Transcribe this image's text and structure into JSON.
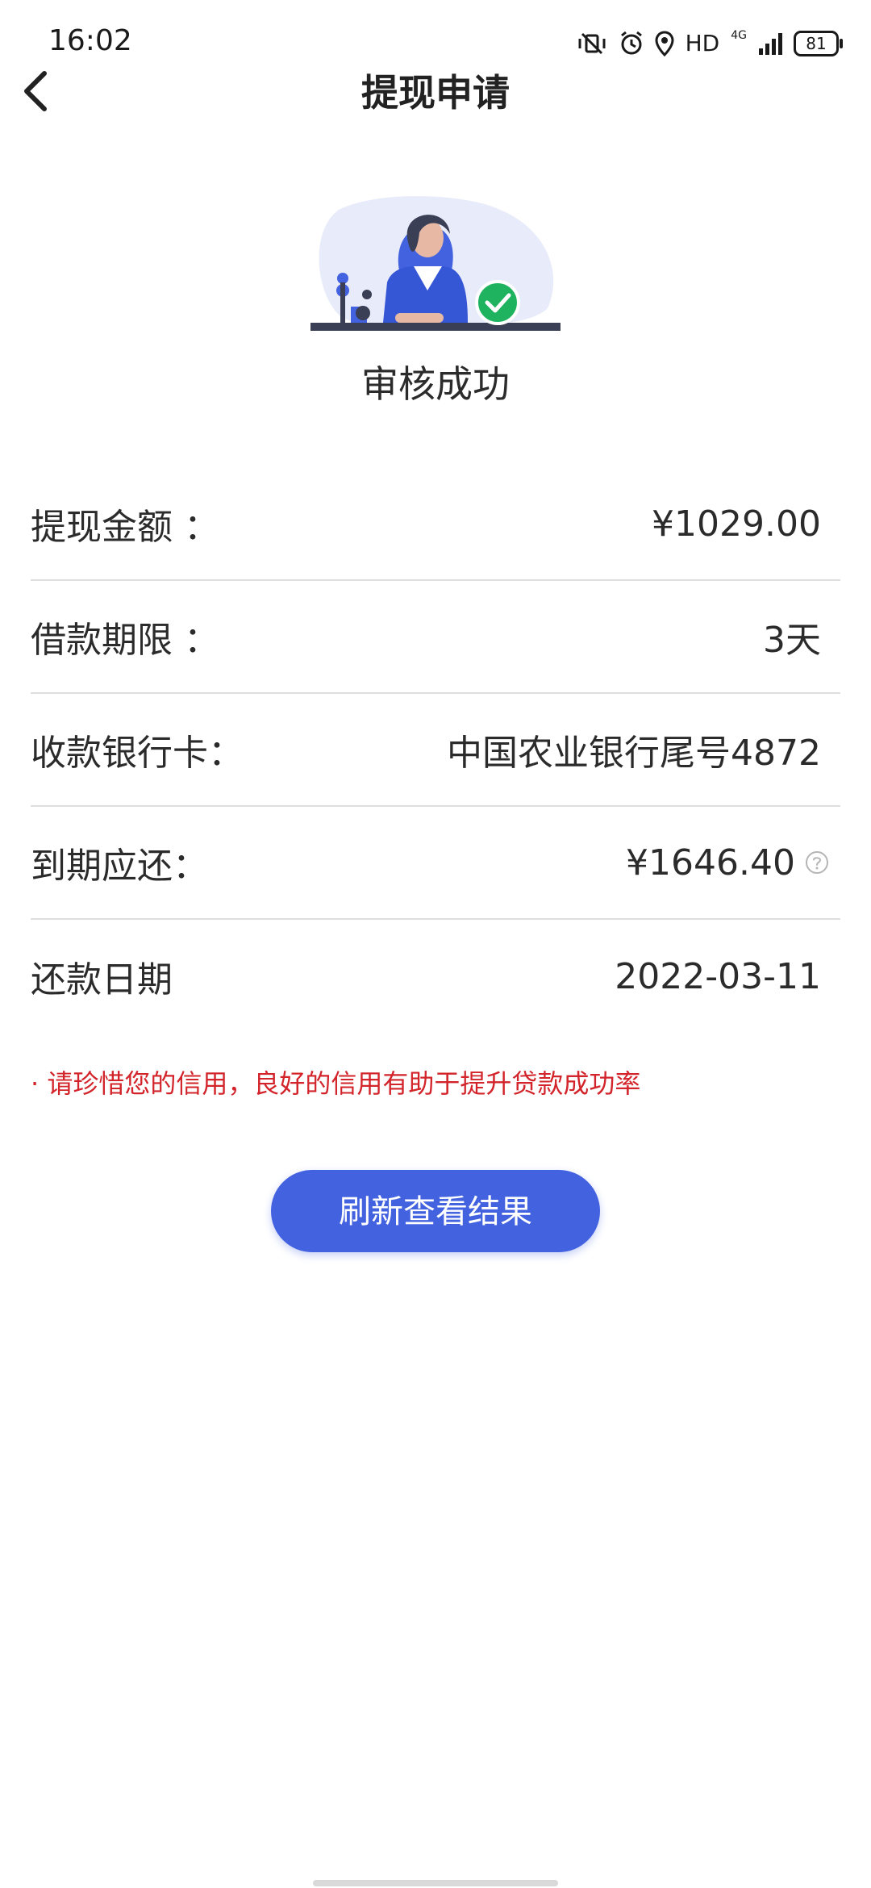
{
  "status_bar": {
    "time": "16:02",
    "hd_label": "HD",
    "network_label": "4G",
    "battery_level": "81"
  },
  "header": {
    "title": "提现申请"
  },
  "result": {
    "title": "审核成功"
  },
  "details": [
    {
      "label": "提现金额 ：",
      "value": "¥1029.00"
    },
    {
      "label": "借款期限 ：",
      "value": "3天"
    },
    {
      "label": "收款银行卡：",
      "value": "中国农业银行尾号4872"
    },
    {
      "label": "到期应还：",
      "value": "¥1646.40"
    },
    {
      "label": "还款日期",
      "value": "2022-03-11"
    }
  ],
  "notice": "· 请珍惜您的信用，良好的信用有助于提升贷款成功率",
  "actions": {
    "refresh_label": "刷新查看结果"
  },
  "colors": {
    "accent": "#4362e0",
    "notice": "#d2242a",
    "success": "#1fb35f",
    "divider": "#dedede"
  },
  "icons": {
    "back": "chevron-left-icon",
    "help": "question-circle-icon",
    "success": "check-circle-icon"
  }
}
